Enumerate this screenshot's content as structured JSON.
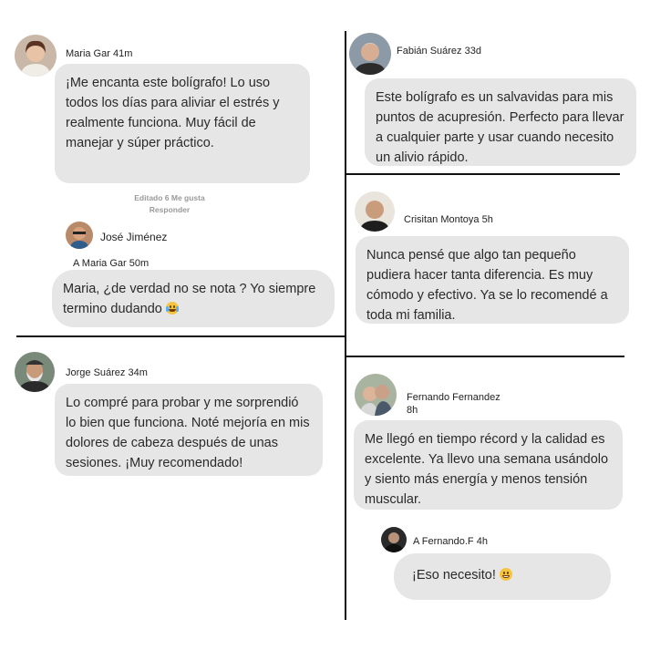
{
  "comments": {
    "c1": {
      "author": "Maria Gar 41m",
      "text": "¡Me encanta este bolígrafo! Lo uso todos los días para aliviar el estrés y realmente funciona. Muy fácil de manejar y súper práctico.",
      "meta_line1": "Editado 6 Me gusta",
      "meta_line2": "Responder"
    },
    "c1_reply": {
      "author": "José Jiménez",
      "to": "A Maria Gar 50m",
      "text": "Maria, ¿de verdad no se nota ? Yo siempre termino dudando",
      "emoji": "crying-laughing-emoji"
    },
    "c2": {
      "author": "Jorge Suárez 34m",
      "text": "Lo compré para probar y me sorprendió lo bien que funciona. Noté mejoría en mis dolores de cabeza después de unas sesiones. ¡Muy recomendado!"
    },
    "c3": {
      "author": "Fabián Suárez 33d",
      "text": "Este bolígrafo es un salvavidas para mis puntos de acupresión. Perfecto para llevar a cualquier parte y usar cuando necesito un alivio rápido."
    },
    "c4": {
      "author": "Crisitan Montoya 5h",
      "text": "Nunca pensé que algo tan pequeño pudiera hacer tanta diferencia. Es muy cómodo y efectivo. Ya se lo recomendé a toda mi familia."
    },
    "c5": {
      "author_line1": "Fernando Fernandez",
      "author_line2": "8h",
      "text": "Me llegó en tiempo récord y la calidad es excelente. Ya llevo una semana usándolo y siento más energía y menos tensión muscular."
    },
    "c5_reply": {
      "author": "A Fernando.F 4h",
      "text": "¡Eso necesito!",
      "emoji": "grinning-emoji"
    }
  }
}
